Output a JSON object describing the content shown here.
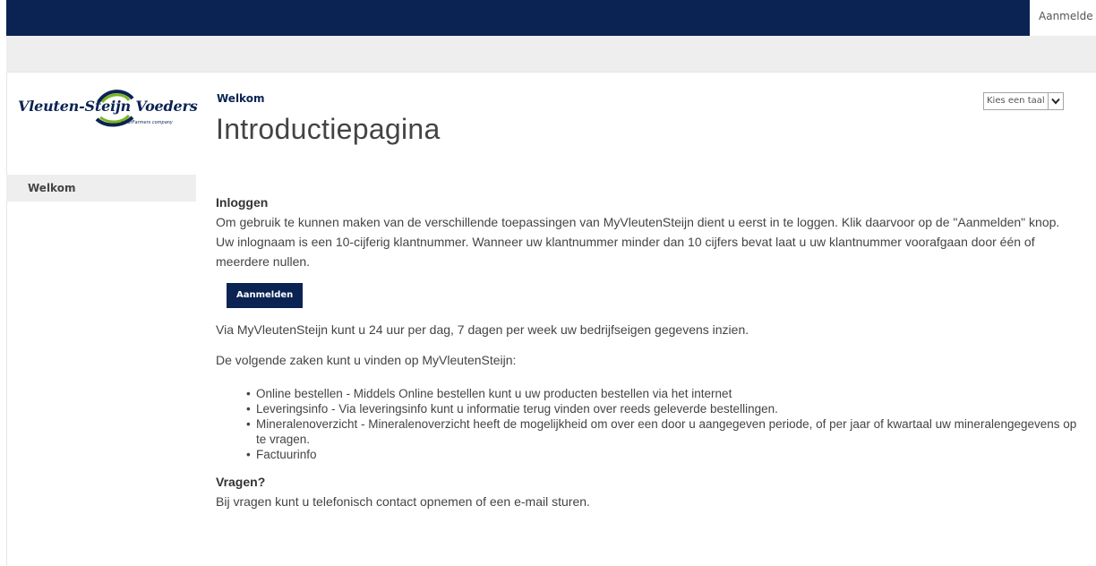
{
  "header": {
    "signin_label": "Aanmelde",
    "bar_color": "#0b2353"
  },
  "logo": {
    "text": "Vleuten-Steijn Voeders",
    "subtext": "a ForFarmers company"
  },
  "nav": {
    "items": [
      {
        "label": "Welkom"
      }
    ]
  },
  "page": {
    "breadcrumb": "Welkom",
    "title": "Introductiepagina"
  },
  "language": {
    "selected": "Kies een taal"
  },
  "content": {
    "login_heading": "Inloggen",
    "login_text": "Om gebruik te kunnen maken van de verschillende toepassingen van MyVleutenSteijn dient u eerst in te loggen. Klik daarvoor op de \"Aanmelden\" knop. Uw inlognaam is een 10-cijferig klantnummer. Wanneer uw klantnummer minder dan 10 cijfers bevat laat u uw klantnummer voorafgaan door één of meerdere nullen.",
    "login_button": "Aanmelden",
    "p1": "Via MyVleutenSteijn kunt u 24 uur per dag, 7 dagen per week uw bedrijfseigen gegevens inzien.",
    "p2": "De volgende zaken kunt u vinden op MyVleutenSteijn:",
    "list": [
      "Online bestellen - Middels Online bestellen kunt u uw producten bestellen via het internet",
      "Leveringsinfo - Via leveringsinfo kunt u informatie terug vinden over reeds geleverde bestellingen.",
      "Mineralenoverzicht - Mineralenoverzicht heeft de mogelijkheid om over een door u aangegeven periode, of per jaar of kwartaal uw mineralengegevens op te vragen.",
      "Factuurinfo"
    ],
    "questions_heading": "Vragen?",
    "questions_text": "Bij vragen kunt u telefonisch contact opnemen of een e-mail sturen."
  }
}
